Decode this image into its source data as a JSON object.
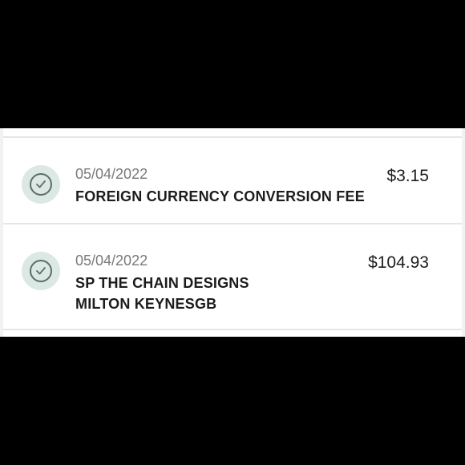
{
  "transactions": [
    {
      "status_icon": "check-circle-icon",
      "date": "05/04/2022",
      "description_line1": "FOREIGN CURRENCY CONVERSION FEE",
      "description_line2": "",
      "amount": "$3.15"
    },
    {
      "status_icon": "check-circle-icon",
      "date": "05/04/2022",
      "description_line1": "SP THE CHAIN DESIGNS",
      "description_line2": "MILTON KEYNESGB",
      "amount": "$104.93"
    }
  ],
  "colors": {
    "icon_bg": "#dbe8e3",
    "icon_stroke": "#5b6f68",
    "date_text": "#7a7a7a",
    "primary_text": "#1c1c1c"
  }
}
